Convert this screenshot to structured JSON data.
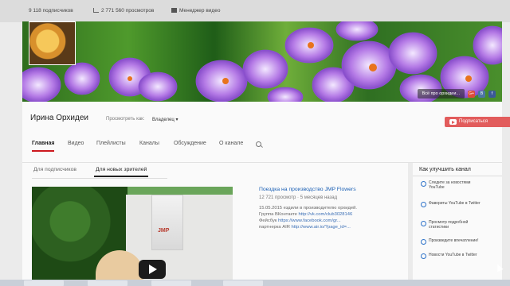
{
  "stats": {
    "subscribers": "9 118 подписчиков",
    "views": "2 771 560 просмотров",
    "manager": "Менеджер видео"
  },
  "banner": {
    "links_label": "Всё про орхидеи...",
    "social": [
      "G+",
      "B",
      "f"
    ]
  },
  "channel": {
    "name": "Ирина Орхидеи",
    "view_as_label": "Просмотреть как:",
    "view_as_value": "Владелец",
    "subscribe_label": "Подписаться"
  },
  "tabs": [
    "Главная",
    "Видео",
    "Плейлисты",
    "Каналы",
    "Обсуждение",
    "О канале"
  ],
  "subtabs": [
    "Для подписчиков",
    "Для новых зрителей"
  ],
  "video": {
    "title": "Поездка на производство JMP Flowers",
    "meta": "12 721 просмотр · 5 месяцев назад",
    "desc_lines": [
      {
        "text": "15.05.2015 ездили в производителю орхидей.",
        "link": ""
      },
      {
        "text": "Группа ВКонтакте ",
        "link": "http://vk.com/club3028146"
      },
      {
        "text": "Фейсбук ",
        "link": "https://www.facebook.com/gr..."
      },
      {
        "text": "партнерка AIR ",
        "link": "http://www.air.io/?page_id=..."
      }
    ],
    "logo": "JMP"
  },
  "sidebar": {
    "title": "Как улучшить канал",
    "tips": [
      "Следите за новостями YouTube",
      "Фавориты YouTube в Twitter",
      "Просмотр подробной статистики",
      "Произведите впечатление!",
      "Новости YouTube в Twitter"
    ]
  },
  "colors": {
    "accent_red": "#cc181e",
    "subscribe_red": "#e25c5c",
    "link_blue": "#1a5fb4"
  }
}
